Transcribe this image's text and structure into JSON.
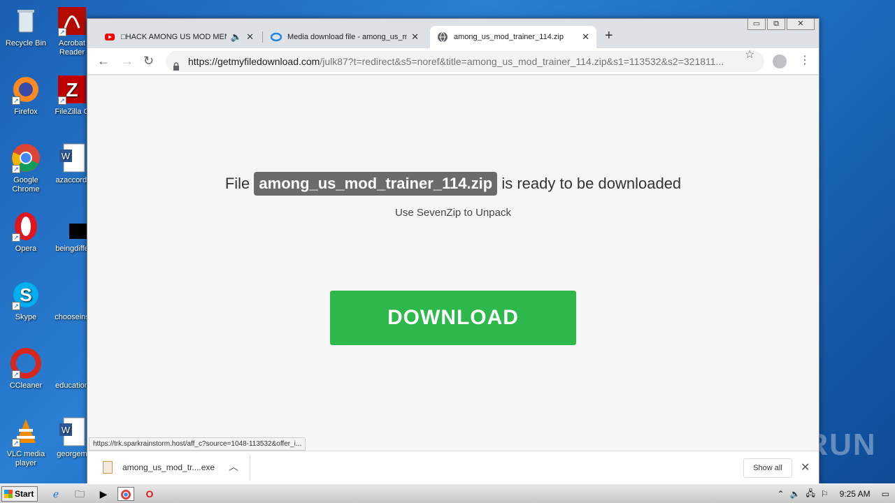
{
  "desktop": {
    "icons": [
      {
        "label": "Recycle Bin"
      },
      {
        "label": "Acrobat Reader"
      },
      {
        "label": "Firefox"
      },
      {
        "label": "FileZilla C"
      },
      {
        "label": "Google Chrome"
      },
      {
        "label": "azaccordi"
      },
      {
        "label": "Opera"
      },
      {
        "label": "beingdiffe"
      },
      {
        "label": "Skype"
      },
      {
        "label": "chooseins"
      },
      {
        "label": "CCleaner"
      },
      {
        "label": "education"
      },
      {
        "label": "VLC media player"
      },
      {
        "label": "georgem"
      }
    ]
  },
  "browser": {
    "tabs": [
      {
        "title": "□HACK AMONG US MOD MENU",
        "icon": "youtube-icon"
      },
      {
        "title": "Media download file - among_us_mo",
        "icon": "media-icon"
      },
      {
        "title": "among_us_mod_trainer_114.zip",
        "icon": "globe-icon"
      }
    ],
    "window_buttons": {
      "minimize": "▭",
      "restore": "⧉",
      "close": "✕"
    },
    "address": {
      "host": "https://getmyfiledownload.com",
      "rest": "/julk87?t=redirect&s5=noref&title=among_us_mod_trainer_114.zip&s1=113532&s2=321811..."
    }
  },
  "page": {
    "prefix": "File",
    "filename": "among_us_mod_trainer_114.zip",
    "suffix": "is ready to be downloaded",
    "subtitle": "Use SevenZip to Unpack",
    "download_label": "DOWNLOAD",
    "status_url": "https://trk.sparkrainstorm.host/aff_c?source=1048-113532&offer_i..."
  },
  "downloads": {
    "file": "among_us_mod_tr....exe",
    "show_all": "Show all"
  },
  "watermark": "ANY RUN",
  "taskbar": {
    "start": "Start",
    "clock": "9:25 AM"
  }
}
